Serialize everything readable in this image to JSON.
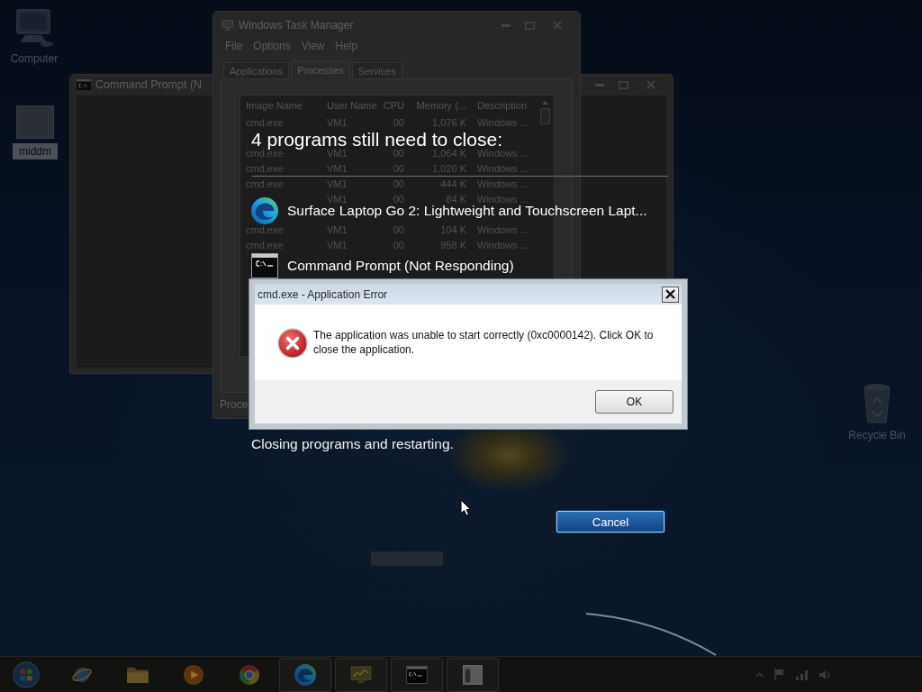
{
  "desktop_icons": [
    {
      "label": "Computer",
      "kind": "computer",
      "selected": false
    },
    {
      "label": "middm",
      "kind": "file",
      "selected": true
    },
    {
      "label": "Recycle Bin",
      "kind": "recycle_bin",
      "selected": false
    }
  ],
  "command_prompt_window": {
    "title": "Command Prompt (N"
  },
  "task_manager": {
    "title": "Windows Task Manager",
    "menu": [
      "File",
      "Options",
      "View",
      "Help"
    ],
    "tabs": [
      {
        "label": "Applications",
        "selected": false
      },
      {
        "label": "Processes",
        "selected": true
      },
      {
        "label": "Services",
        "selected": false
      }
    ],
    "columns": [
      "Image Name",
      "User Name",
      "CPU",
      "Memory (...",
      "Description"
    ],
    "rows": [
      [
        "cmd.exe",
        "VM1",
        "00",
        "1,076 K",
        "Windows ..."
      ],
      [
        null,
        null,
        null,
        null,
        null
      ],
      [
        "cmd.exe",
        "VM1",
        "00",
        "1,064 K",
        "Windows ..."
      ],
      [
        "cmd.exe",
        "VM1",
        "00",
        "1,020 K",
        "Windows ..."
      ],
      [
        "cmd.exe",
        "VM1",
        "00",
        "444 K",
        "Windows ..."
      ],
      [
        null,
        "VM1",
        "00",
        "84 K",
        "Windows ..."
      ],
      [
        null,
        null,
        null,
        null,
        null
      ],
      [
        "cmd.exe",
        "VM1",
        "00",
        "104 K",
        "Windows ..."
      ],
      [
        "cmd.exe",
        "VM1",
        "00",
        "958 K",
        "Windows ..."
      ]
    ],
    "status_bar": "Proce"
  },
  "shutdown_screen": {
    "heading": "4 programs still need to close:",
    "programs": [
      {
        "name": "Surface Laptop Go 2: Lightweight and Touchscreen Lapt...",
        "kind": "browser"
      },
      {
        "name": "Command Prompt (Not Responding)",
        "kind": "console"
      }
    ],
    "status": "Closing programs and restarting.",
    "cancel_button": "Cancel"
  },
  "error_dialog": {
    "title": "cmd.exe - Application Error",
    "message": "The application was unable to start correctly (0xc0000142). Click OK to close the application.",
    "ok_button": "OK"
  },
  "taskbar": {
    "apps": [
      {
        "kind": "planet",
        "running": false
      },
      {
        "kind": "folder",
        "running": false
      },
      {
        "kind": "media",
        "running": false
      },
      {
        "kind": "wheel",
        "running": false
      },
      {
        "kind": "swirl",
        "running": true
      },
      {
        "kind": "monitor",
        "running": true
      },
      {
        "kind": "console",
        "running": true
      },
      {
        "kind": "window",
        "running": true
      }
    ]
  }
}
